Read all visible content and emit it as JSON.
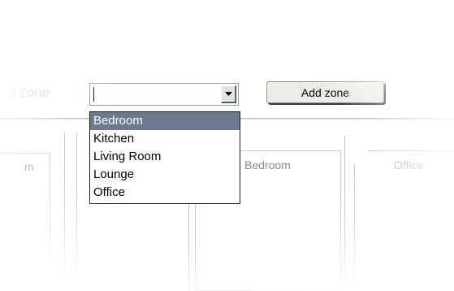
{
  "zone_label": "d zone",
  "combo": {
    "value": "",
    "options": [
      "Bedroom",
      "Kitchen",
      "Living Room",
      "Lounge",
      "Office"
    ],
    "highlighted_index": 0
  },
  "add_button_label": "Add zone",
  "rooms": {
    "left_partial": "m",
    "bedroom": "Bedroom",
    "office": "Office"
  }
}
